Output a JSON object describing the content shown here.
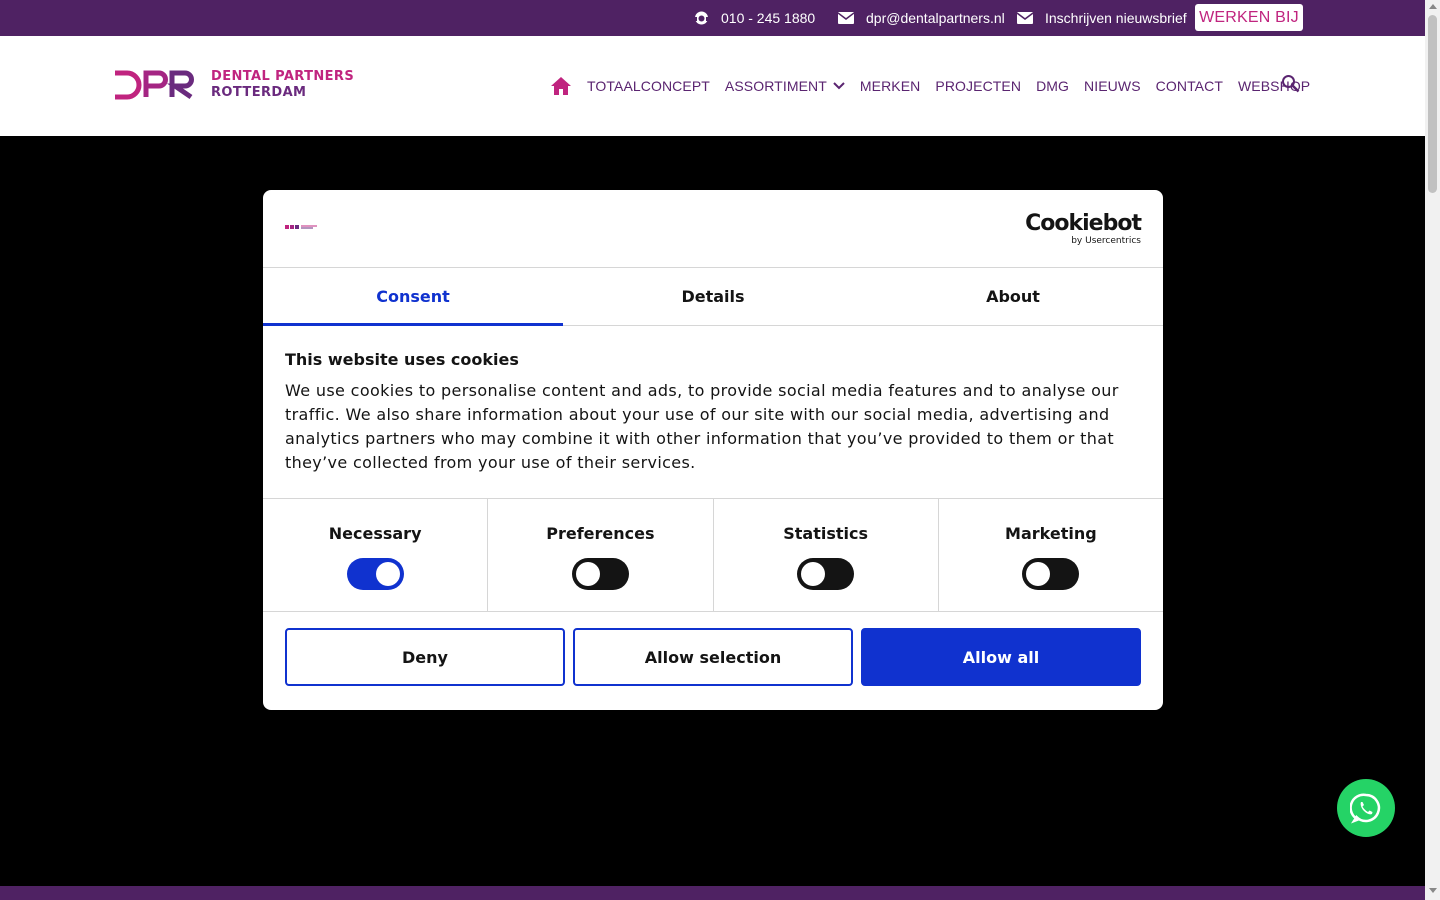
{
  "topbar": {
    "phone": "010 - 245 1880",
    "email": "dpr@dentalpartners.nl",
    "newsletter": "Inschrijven nieuwsbrief",
    "jobs_button": "WERKEN BIJ"
  },
  "header": {
    "logo_line1": "DENTAL PARTNERS",
    "logo_line2": "ROTTERDAM",
    "nav": [
      {
        "label": "TOTAALCONCEPT"
      },
      {
        "label": "ASSORTIMENT"
      },
      {
        "label": "MERKEN"
      },
      {
        "label": "PROJECTEN"
      },
      {
        "label": "DMG"
      },
      {
        "label": "NIEUWS"
      },
      {
        "label": "CONTACT"
      },
      {
        "label": "WEBSHOP"
      }
    ]
  },
  "cookie_dialog": {
    "brand": "Cookiebot",
    "brand_sub": "by Usercentrics",
    "tabs": [
      {
        "label": "Consent",
        "active": true
      },
      {
        "label": "Details",
        "active": false
      },
      {
        "label": "About",
        "active": false
      }
    ],
    "title": "This website uses cookies",
    "text": "We use cookies to personalise content and ads, to provide social media features and to analyse our traffic. We also share information about your use of our site with our social media, advertising and analytics partners who may combine it with other information that you’ve provided to them or that they’ve collected from your use of their services.",
    "preferences": [
      {
        "label": "Necessary",
        "checked": true
      },
      {
        "label": "Preferences",
        "checked": false
      },
      {
        "label": "Statistics",
        "checked": false
      },
      {
        "label": "Marketing",
        "checked": false
      }
    ],
    "buttons": {
      "deny": "Deny",
      "allow_selection": "Allow selection",
      "allow_all": "Allow all"
    }
  },
  "colors": {
    "topbar": "#4f2263",
    "brand_magenta": "#c0247f",
    "nav_purple": "#5a2470",
    "cookie_blue": "#1032cf",
    "whatsapp_green": "#25d366"
  }
}
